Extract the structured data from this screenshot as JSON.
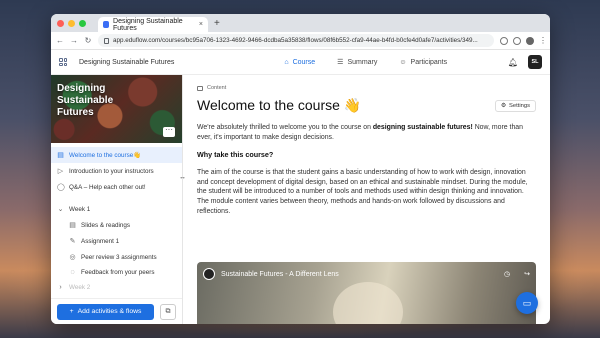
{
  "browser": {
    "tab_title": "Designing Sustainable Futures",
    "tab_close": "×",
    "new_tab": "+",
    "url": "app.eduflow.com/courses/bc95a706-1323-4692-9466-dcdba5a35838/flows/08f6b552-cfa9-44ae-b4fd-b0cfe4d0afe7/activities/349..."
  },
  "appbar": {
    "title": "Designing Sustainable Futures",
    "tabs": [
      {
        "label": "Course",
        "icon": "home-icon"
      },
      {
        "label": "Summary",
        "icon": "summary-icon"
      },
      {
        "label": "Participants",
        "icon": "participants-icon"
      }
    ],
    "user_initials": "SL"
  },
  "sidebar": {
    "hero_title": "Designing Sustainable Futures",
    "more": "···",
    "items": [
      {
        "label": "Welcome to the course👋",
        "icon": "content-icon"
      },
      {
        "label": "Introduction to your instructors",
        "icon": "play-icon"
      },
      {
        "label": "Q&A – Help each other out!",
        "icon": "chat-icon"
      },
      {
        "label": "Week 1",
        "icon": "chevron-down-icon"
      },
      {
        "label": "Slides & readings",
        "icon": "content-icon"
      },
      {
        "label": "Assignment 1",
        "icon": "edit-icon"
      },
      {
        "label": "Peer review 3 assignments",
        "icon": "review-icon"
      },
      {
        "label": "Feedback from your peers",
        "icon": "feedback-icon"
      },
      {
        "label": "Week 2",
        "icon": "chevron-right-icon"
      }
    ],
    "add_button": "Add activities & flows"
  },
  "main": {
    "content_label": "Content",
    "title": "Welcome to the course 👋",
    "settings_label": "Settings",
    "intro_before": "We're absolutely thrilled to welcome you to the course on ",
    "intro_bold": "designing sustainable futures!",
    "intro_after": " Now, more than ever, it's important to make design decisions.",
    "heading": "Why take this course?",
    "body": "The aim of the course is that the student gains a basic understanding of how to work with design, innovation and concept development of digital design, based on an ethical and sustainable mindset. During the module, the student will be introduced to a number of tools and methods used within design thinking and innovation. The module content varies between theory, methods and hands-on work followed by discussions and reflections.",
    "video_title": "Sustainable Futures - A Different Lens"
  },
  "colors": {
    "accent": "#1e6fe0",
    "active_bg": "#e8f0fd"
  }
}
